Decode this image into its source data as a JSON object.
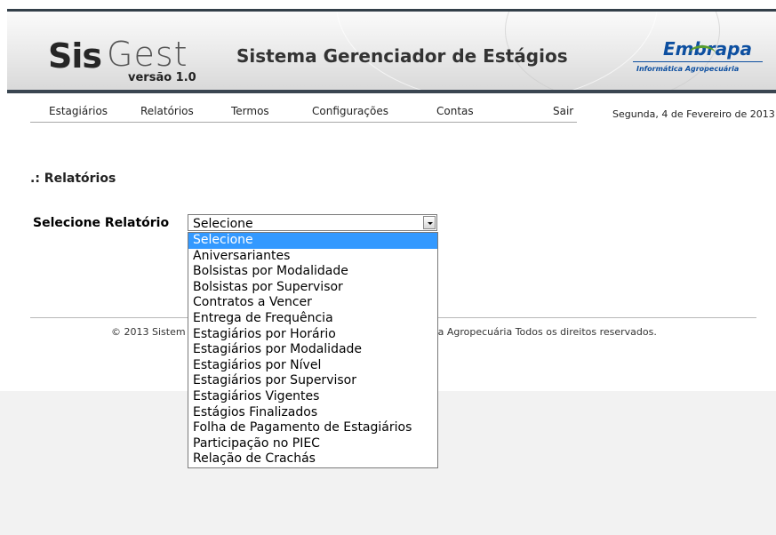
{
  "header": {
    "logo_sis": "Sis",
    "logo_gest": "Gest",
    "version": "versão 1.0",
    "title": "Sistema Gerenciador de Estágios",
    "partner_logo": "Embrapa",
    "partner_subtitle": "Informática Agropecuária"
  },
  "nav": {
    "items": [
      "Estagiários",
      "Relatórios",
      "Termos",
      "Configurações",
      "Contas",
      "Sair"
    ],
    "date": "Segunda, 4 de Fevereiro de 2013"
  },
  "main": {
    "section_title": ".: Relatórios",
    "select_label": "Selecione Relatório",
    "select_value": "Selecione",
    "options": [
      "Selecione",
      "Aniversariantes",
      "Bolsistas por Modalidade",
      "Bolsistas por Supervisor",
      "Contratos a Vencer",
      "Entrega de Frequência",
      "Estagiários por Horário",
      "Estagiários por Modalidade",
      "Estagiários por Nível",
      "Estagiários por Supervisor",
      "Estagiários Vigentes",
      "Estágios Finalizados",
      "Folha de Pagamento de Estagiários",
      "Participação no PIEC",
      "Relação de Crachás"
    ],
    "selected_option": "Selecione"
  },
  "footer": {
    "copyright_left": "© 2013 Sistem",
    "copyright_right": "ca Agropecuária Todos os direitos reservados."
  },
  "colors": {
    "selection": "#3399ff",
    "partner_blue": "#0d4fa0",
    "partner_green": "#5b9f2e",
    "banner_border": "#3a4651"
  }
}
